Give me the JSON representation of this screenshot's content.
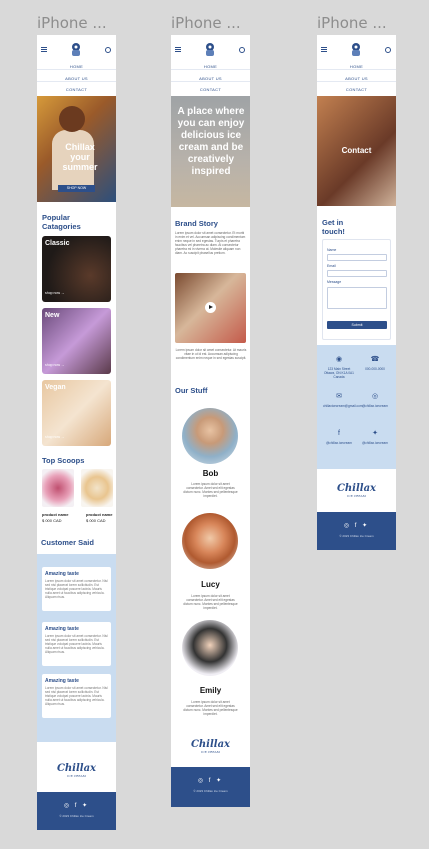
{
  "frames": {
    "label": "iPhone ..."
  },
  "nav": {
    "home": "HOME",
    "about": "ABOUT US",
    "contact": "CONTACT"
  },
  "home": {
    "hero_title": "Chillax your summer",
    "hero_button": "SHOP NOW",
    "popular_title": "Popular Catagories",
    "categories": [
      {
        "label": "Classic",
        "link": "shop now →"
      },
      {
        "label": "New",
        "link": "shop now →"
      },
      {
        "label": "Vegan",
        "link": "shop now →"
      }
    ],
    "top_scoops_title": "Top Scoops",
    "products": [
      {
        "name": "product name",
        "price": "$ 000 CAD"
      },
      {
        "name": "product name",
        "price": "$ 000 CAD"
      }
    ],
    "customer_said_title": "Customer Said",
    "testimonials": [
      {
        "title": "Amazing taste",
        "body": "Lorem ipsum dolor sit amet consectetur. Nisl sed nisl placerat lorem sollicitudin. Est tristique volutpat posuere lacinia. Mauris nulla amet ut faucibus adipiscing vehicula. Aliquam risus."
      },
      {
        "title": "Amazing taste",
        "body": "Lorem ipsum dolor sit amet consectetur. Nisl sed nisl placerat lorem sollicitudin. Est tristique volutpat posuere lacinia. Mauris nulla amet ut faucibus adipiscing vehicula. Aliquam risus."
      },
      {
        "title": "Amazing taste",
        "body": "Lorem ipsum dolor sit amet consectetur. Nisl sed nisl placerat lorem sollicitudin. Est tristique volutpat posuere lacinia. Mauris nulla amet ut faucibus adipiscing vehicula. Aliquam risus."
      }
    ]
  },
  "about": {
    "hero_title": "A place where you can enjoy delicious ice cream and be creatively inspired",
    "brand_story_title": "Brand Story",
    "brand_story_text": "Lorem ipsum dolor sit amet consectetur. Et morbi in enim et vel. Accumsan adipiscing condimentum enim neque in sed egestas. Turpis et pharetra faucibus vel pharetra ac diam. At consectetur pharetra mi in viverra at. Molestie aliquam non diam. Ac suscipit phasellus pretium.",
    "video_caption": "Lorem ipsum dolor sit amet consectetur. At mauris vitae in ut id est. Accumsan adipiscing condimentum enim neque in sed egestas suscipit.",
    "our_stuff_title": "Our Stuff",
    "staff": [
      {
        "name": "Bob",
        "text": "Lorem ipsum dolor sit amet consectetur. Amet sed elit egestas dictum nunc. Montes sed pellentesque imperdiet."
      },
      {
        "name": "Lucy",
        "text": "Lorem ipsum dolor sit amet consectetur. Amet sed elit egestas dictum nunc. Montes sed pellentesque imperdiet."
      },
      {
        "name": "Emily",
        "text": "Lorem ipsum dolor sit amet consectetur. Amet sed elit egestas dictum nunc. Montes sed pellentesque imperdiet."
      }
    ]
  },
  "contact": {
    "hero_title": "Contact",
    "get_in_touch": "Get in touch!",
    "form": {
      "name": "Name",
      "email": "Email",
      "message": "Message",
      "submit": "Submit"
    },
    "info": [
      {
        "icon": "map-pin-icon",
        "glyph": "◉",
        "text": "123 Main Street Ottawa, ON K1A 0A1 Canada"
      },
      {
        "icon": "phone-icon",
        "glyph": "☎",
        "text": "000-000-0000"
      },
      {
        "icon": "mail-icon",
        "glyph": "✉",
        "text": "chillaxicecream@gmail.com"
      },
      {
        "icon": "instagram-icon",
        "glyph": "◎",
        "text": "@chillax.icecream"
      },
      {
        "icon": "facebook-icon",
        "glyph": "f",
        "text": "@chillax.icecream"
      },
      {
        "icon": "twitter-icon",
        "glyph": "✦",
        "text": "@chillax.icecream"
      }
    ]
  },
  "brand": {
    "logo": "Chillax",
    "logo_sub": "ICE CREAM"
  },
  "footer": {
    "social": "◎ f ✦",
    "copyright": "© 2023 Chillax Ice Cream"
  },
  "colors": {
    "primary": "#2d4f8a",
    "light_blue": "#c9dcf0",
    "canvas": "#d9d9d9"
  }
}
